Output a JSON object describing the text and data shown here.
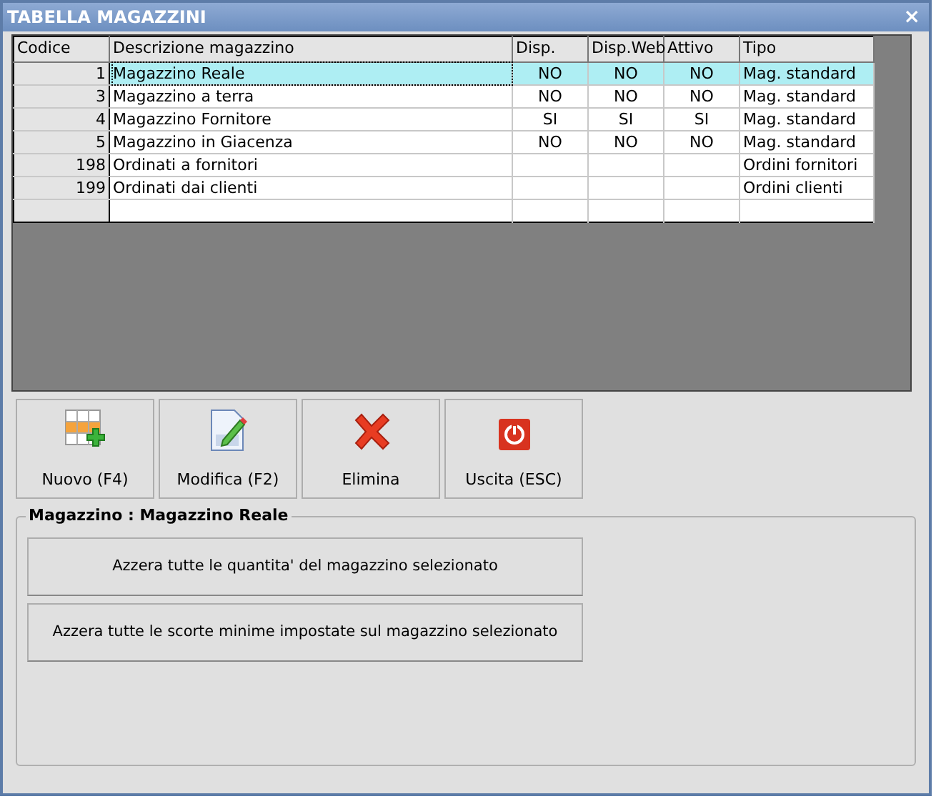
{
  "window": {
    "title": "TABELLA MAGAZZINI",
    "close": "×"
  },
  "table": {
    "columns": [
      "Codice",
      "Descrizione magazzino",
      "Disp.",
      "Disp.Web",
      "Attivo",
      "Tipo"
    ],
    "rows": [
      {
        "cells": [
          "1",
          "Magazzino Reale",
          "NO",
          "NO",
          "NO",
          "Mag. standard"
        ],
        "selected": true
      },
      {
        "cells": [
          "3",
          "Magazzino a terra",
          "NO",
          "NO",
          "NO",
          "Mag. standard"
        ],
        "selected": false
      },
      {
        "cells": [
          "4",
          "Magazzino Fornitore",
          "SI",
          "SI",
          "SI",
          "Mag. standard"
        ],
        "selected": false
      },
      {
        "cells": [
          "5",
          "Magazzino in Giacenza",
          "NO",
          "NO",
          "NO",
          "Mag. standard"
        ],
        "selected": false
      },
      {
        "cells": [
          "198",
          "Ordinati a fornitori",
          "",
          "",
          "",
          "Ordini fornitori"
        ],
        "selected": false
      },
      {
        "cells": [
          "199",
          "Ordinati dai clienti",
          "",
          "",
          "",
          "Ordini clienti"
        ],
        "selected": false
      }
    ]
  },
  "toolbar": [
    {
      "label": "Nuovo (F4)",
      "kind": "new"
    },
    {
      "label": "Modifica (F2)",
      "kind": "edit"
    },
    {
      "label": "Elimina",
      "kind": "delete"
    },
    {
      "label": "Uscita (ESC)",
      "kind": "exit"
    }
  ],
  "group": {
    "title": "Magazzino : Magazzino Reale",
    "buttons": [
      "Azzera tutte le quantita' del magazzino selezionato",
      "Azzera tutte le scorte minime impostate sul magazzino selezionato"
    ]
  }
}
